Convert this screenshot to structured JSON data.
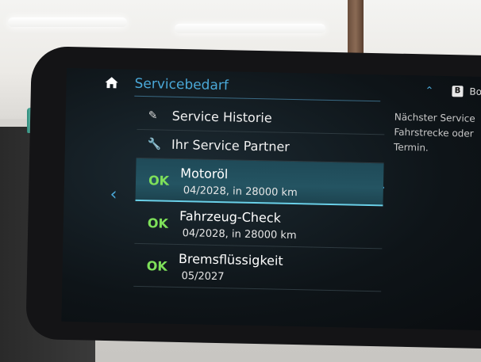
{
  "header": {
    "title": "Servicebedarf",
    "badge_letter": "B",
    "badge_text": "Bo"
  },
  "right_panel": {
    "lines": [
      "Nächster Service",
      "Fahrstrecke oder",
      "Termin."
    ]
  },
  "menu": {
    "items": [
      {
        "label": "Service Historie",
        "icon": "service-history-icon"
      },
      {
        "label": "Ihr Service Partner",
        "icon": "wrench-icon"
      }
    ]
  },
  "services": [
    {
      "status": "OK",
      "name": "Motoröl",
      "due": "04/2028, in 28000 km",
      "selected": true
    },
    {
      "status": "OK",
      "name": "Fahrzeug-Check",
      "due": "04/2028, in 28000 km",
      "selected": false
    },
    {
      "status": "OK",
      "name": "Bremsflüssigkeit",
      "due": "05/2027",
      "selected": false
    }
  ],
  "colors": {
    "accent": "#4aa8d8",
    "ok": "#7ee05a",
    "selected_bg": "#245462",
    "screen_bg": "#0e1418"
  }
}
